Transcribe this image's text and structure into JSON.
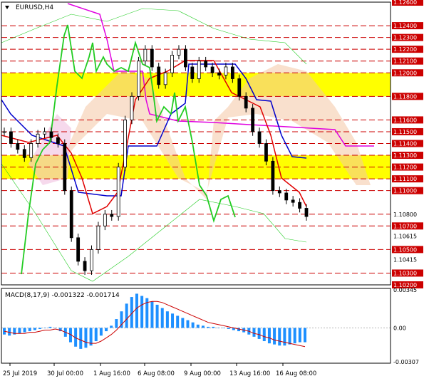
{
  "symbol_title": "EURUSD,H4",
  "macd_title": "MACD(8,17,9) -0.001322 -0.001714",
  "colors": {
    "background": "#ffffff",
    "price_candles": "#000000",
    "kijun": "#0000cc",
    "tenkan": "#e00000",
    "chikou": "#22cc22",
    "senkou_b_line": "#e000e0",
    "cloud_bull": "#f4c6a4",
    "cloud_bear": "#f0c0e0",
    "yellow_zone": "#ffff00",
    "level_line": "#cc0000",
    "price_tag_bg": "#cc0000",
    "macd_hist": "#1e90ff",
    "macd_signal": "#cc0000",
    "bollinger": "#22cc22"
  },
  "chart_data": [
    {
      "type": "candlestick",
      "title": "EURUSD,H4",
      "y_tick_labels": [
        "1.12600",
        "1.12400",
        "1.12300",
        "1.12200",
        "1.12100",
        "1.12000",
        "1.11800",
        "1.11600",
        "1.11500",
        "1.11400",
        "1.11300",
        "1.11200",
        "1.11100",
        "1.11000",
        "1.10800",
        "1.10700",
        "1.10615",
        "1.10500",
        "1.10415",
        "1.10300",
        "1.10200"
      ],
      "highlighted_levels": [
        "1.12600",
        "1.12400",
        "1.12300",
        "1.12200",
        "1.12100",
        "1.12000",
        "1.11800",
        "1.11600",
        "1.11500",
        "1.11400",
        "1.11300",
        "1.11200",
        "1.11100",
        "1.11000",
        "1.10800",
        "1.10700",
        "1.10500",
        "1.10300",
        "1.10200"
      ],
      "yellow_zones": [
        [
          1.118,
          1.12
        ],
        [
          1.111,
          1.113
        ]
      ],
      "ylim": [
        1.102,
        1.126
      ],
      "x_tick_labels": [
        "25 Jul 2019",
        "30 Jul 00:00",
        "1 Aug 16:00",
        "6 Aug 08:00",
        "9 Aug 00:00",
        "13 Aug 16:00",
        "16 Aug 08:00"
      ],
      "series": [
        {
          "name": "close",
          "values": [
            1.115,
            1.114,
            1.1135,
            1.1128,
            1.114,
            1.1148,
            1.115,
            1.1145,
            1.114,
            1.11,
            1.106,
            1.104,
            1.1032,
            1.105,
            1.107,
            1.108,
            1.1078,
            1.112,
            1.116,
            1.118,
            1.121,
            1.122,
            1.1205,
            1.119,
            1.12,
            1.1215,
            1.122,
            1.1205,
            1.1195,
            1.121,
            1.1205,
            1.12,
            1.1198,
            1.1205,
            1.1195,
            1.118,
            1.117,
            1.115,
            1.114,
            1.1125,
            1.11,
            1.1098,
            1.1092,
            1.109,
            1.1085,
            1.1078
          ]
        }
      ],
      "price_tags": [
        "1.10800"
      ]
    },
    {
      "type": "bar",
      "title": "MACD(8,17,9) -0.001322 -0.001714",
      "y_tick_labels": [
        "0.00345",
        "0.00",
        "-0.00307"
      ],
      "ylim": [
        -0.00307,
        0.00345
      ],
      "series": [
        {
          "name": "histogram",
          "values": [
            -0.0006,
            -0.0007,
            -0.0006,
            -0.0005,
            -0.0004,
            -0.0003,
            -0.0002,
            -0.0001,
            0.0,
            0.0001,
            0.0,
            -0.0003,
            -0.0008,
            -0.0013,
            -0.0017,
            -0.0019,
            -0.0018,
            -0.0016,
            -0.0012,
            -0.0007,
            -0.0003,
            0.0002,
            0.0008,
            0.0015,
            0.0022,
            0.0028,
            0.0031,
            0.0029,
            0.0027,
            0.0024,
            0.0021,
            0.0018,
            0.0015,
            0.0013,
            0.0011,
            0.0009,
            0.0007,
            0.0005,
            0.0003,
            0.0002,
            0.0001,
            0.0001,
            0.0,
            0.0,
            -0.0001,
            -0.0002,
            -0.0003,
            -0.0004,
            -0.0006,
            -0.0008,
            -0.001,
            -0.0012,
            -0.0014,
            -0.0015,
            -0.0016,
            -0.0016,
            -0.0015,
            -0.0014,
            -0.0013,
            -0.0013
          ]
        },
        {
          "name": "signal",
          "values": [
            -0.0003,
            -0.0004,
            -0.0005,
            -0.0005,
            -0.0005,
            -0.0004,
            -0.0004,
            -0.0003,
            -0.0002,
            -0.0002,
            -0.0001,
            -0.0002,
            -0.0004,
            -0.0006,
            -0.0009,
            -0.0011,
            -0.0013,
            -0.0014,
            -0.0014,
            -0.0012,
            -0.0009,
            -0.0006,
            -0.0002,
            0.0003,
            0.0008,
            0.0013,
            0.0018,
            0.0021,
            0.0023,
            0.0024,
            0.0024,
            0.0023,
            0.0021,
            0.0019,
            0.0017,
            0.0015,
            0.0013,
            0.0011,
            0.0009,
            0.0007,
            0.0005,
            0.0004,
            0.0003,
            0.0002,
            0.0001,
            0.0,
            -0.0001,
            -0.0002,
            -0.0003,
            -0.0005,
            -0.0006,
            -0.0008,
            -0.0009,
            -0.0011,
            -0.0012,
            -0.0013,
            -0.0014,
            -0.0015,
            -0.0016,
            -0.0017
          ]
        }
      ]
    }
  ]
}
